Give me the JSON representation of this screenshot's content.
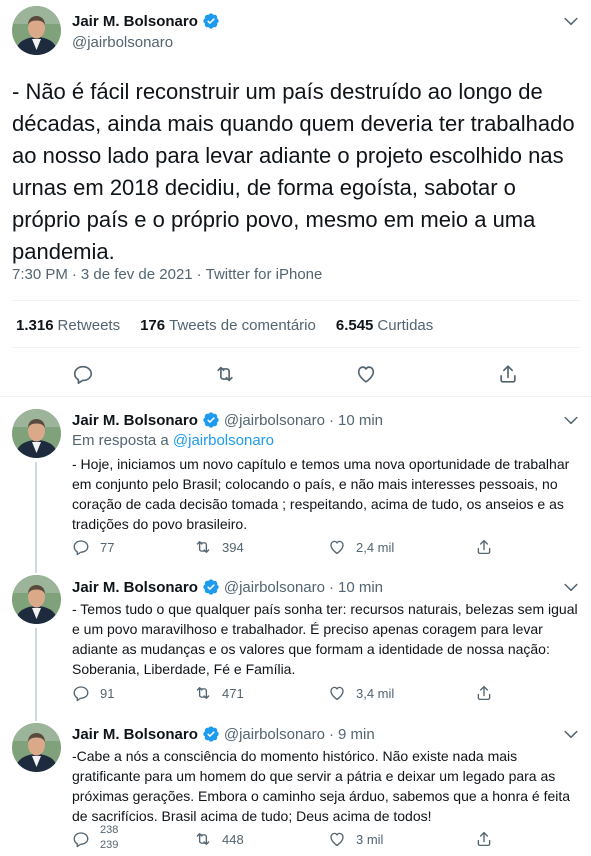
{
  "main_tweet": {
    "name": "Jair M. Bolsonaro",
    "handle": "@jairbolsonaro",
    "text": "- Não é fácil reconstruir um país destruído ao longo de décadas, ainda mais quando quem deveria ter trabalhado ao nosso lado para levar adiante o projeto escolhido nas urnas em 2018 decidiu, de forma egoísta, sabotar o próprio país e o próprio povo, mesmo em meio a uma pandemia.",
    "time": "7:30 PM",
    "date": "3 de fev de 2021",
    "separator": "·",
    "source": "Twitter for iPhone",
    "stats": {
      "retweets_count": "1.316",
      "retweets_label": "Retweets",
      "comments_count": "176",
      "comments_label": "Tweets de comentário",
      "likes_count": "6.545",
      "likes_label": "Curtidas"
    }
  },
  "replies": [
    {
      "name": "Jair M. Bolsonaro",
      "handle": "@jairbolsonaro",
      "dot": "·",
      "time": "10 min",
      "in_reply_prefix": "Em resposta a",
      "in_reply_mention": "@jairbolsonaro",
      "text": "- Hoje, iniciamos um novo capítulo e temos uma nova oportunidade de trabalhar em conjunto pelo Brasil; colocando o país, e não mais interesses pessoais, no coração de cada decisão tomada ; respeitando, acima de tudo, os anseios e as tradições do povo brasileiro.",
      "replies": "77",
      "retweets": "394",
      "likes": "2,4 mil"
    },
    {
      "name": "Jair M. Bolsonaro",
      "handle": "@jairbolsonaro",
      "dot": "·",
      "time": "10 min",
      "text": "- Temos tudo o que qualquer país sonha ter: recursos naturais, belezas sem igual e um povo maravilhoso e trabalhador. É preciso apenas coragem para levar adiante as mudanças e os valores que formam a identidade de nossa nação: Soberania, Liberdade, Fé e Família.",
      "replies": "91",
      "retweets": "471",
      "likes": "3,4 mil"
    },
    {
      "name": "Jair M. Bolsonaro",
      "handle": "@jairbolsonaro",
      "dot": "·",
      "time": "9 min",
      "text": "-Cabe a nós a consciência do momento histórico. Não existe nada mais gratificante para um homem do que servir a pátria e deixar um legado para as próximas gerações. Embora o caminho seja árduo, sabemos que a honra é feita de sacrifícios. Brasil acima de tudo; Deus acima de todos!",
      "replies_prev": "238",
      "replies": "239",
      "retweets": "448",
      "likes": "3 mil"
    }
  ],
  "colors": {
    "accent": "#1d9bf0",
    "text_primary": "#0f1419",
    "text_secondary": "#536471",
    "divider": "#eff3f4"
  },
  "icons": [
    "verified-badge-icon",
    "more-caret-icon",
    "reply-icon",
    "retweet-icon",
    "like-icon",
    "share-icon"
  ]
}
